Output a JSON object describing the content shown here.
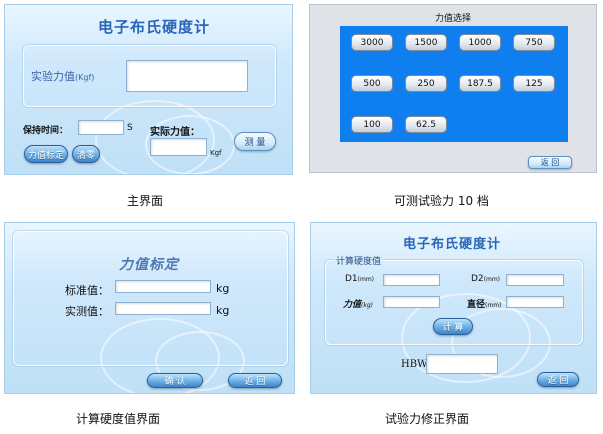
{
  "main_screen": {
    "title": "电子布氏硬度计",
    "test_force_label": "实验力值",
    "test_force_unit": "(Kgf)",
    "hold_time_label": "保持时间：",
    "hold_time_unit": "S",
    "actual_force_label": "实际力值：",
    "actual_force_unit": "Kgf",
    "calibrate_button": "力值标定",
    "clear_button": "清零",
    "measure_button": "测 量"
  },
  "force_select": {
    "title": "力值选择",
    "values": [
      "3000",
      "1500",
      "1000",
      "750",
      "500",
      "250",
      "187.5",
      "125",
      "100",
      "62.5"
    ],
    "back_button": "返 回"
  },
  "calibration": {
    "title": "力值标定",
    "standard_label": "标准值：",
    "measured_label": "实测值：",
    "unit": "kg",
    "confirm_button": "确 认",
    "back_button": "返 回"
  },
  "hardness": {
    "title": "电子布氏硬度计",
    "section_title": "计算硬度值",
    "d1_label": "D1",
    "d1_unit": "(mm)",
    "d2_label": "D2",
    "d2_unit": "(mm)",
    "force_label": "力值",
    "force_unit": "(kg)",
    "diameter_label": "直径",
    "diameter_unit": "(mm)",
    "calc_button": "计 算",
    "hbw_label": "HBW",
    "back_button": "返 回"
  },
  "captions": {
    "main": "主界面",
    "force10": "可测试验力 10 档",
    "hardness": "计算硬度值界面",
    "calibration": "试验力修正界面"
  }
}
